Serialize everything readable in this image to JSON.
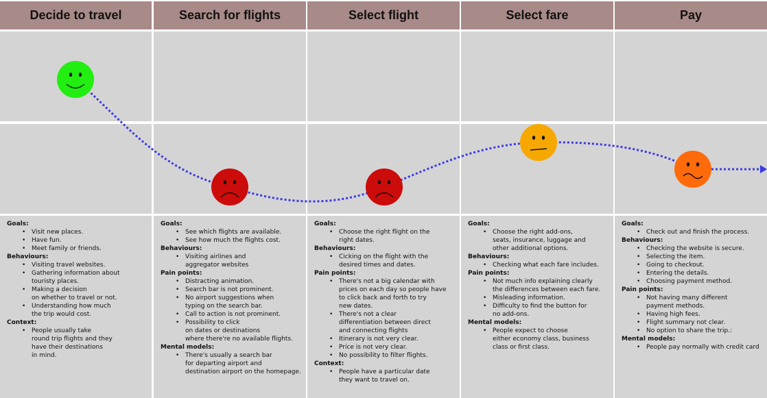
{
  "stages": [
    {
      "title": "Decide to travel",
      "mood": "happy",
      "sections": [
        {
          "label": "Goals:",
          "items": [
            "Visit new places.",
            "Have fun.",
            "Meet family or friends."
          ]
        },
        {
          "label": "Behaviours:",
          "items": [
            "Visiting travel websites.",
            "Gathering information about\ntouristy places.",
            "Making a decision\non whether to travel or not.",
            "Understanding how much\nthe trip would cost."
          ]
        },
        {
          "label": "Context:",
          "items": [
            "People usually take\nround trip flights and they\nhave their destinations\nin mind."
          ]
        }
      ]
    },
    {
      "title": "Search for flights",
      "mood": "sad",
      "sections": [
        {
          "label": "Goals:",
          "items": [
            "See which flights are available.",
            "See how much the flights cost."
          ]
        },
        {
          "label": "Behaviours:",
          "items": [
            "Visiting airlines and\naggregator websites"
          ]
        },
        {
          "label": "Pain points:",
          "items": [
            "Distracting animation.",
            "Search bar is not prominent.",
            "No airport suggestions when\ntyping on the search bar.",
            "Call to action is not prominent.",
            "Possibility to click\non dates or destinations\nwhere there're no available flights."
          ]
        },
        {
          "label": "Mental models:",
          "items": [
            "There's usually a search bar\nfor departing airport and\ndestination airport on the homepage."
          ]
        }
      ]
    },
    {
      "title": "Select flight",
      "mood": "sad",
      "sections": [
        {
          "label": "Goals:",
          "items": [
            "Choose the right flight on the\nright dates."
          ]
        },
        {
          "label": "Behaviours:",
          "items": [
            "Cicking on the flight with the\ndesired times and dates."
          ]
        },
        {
          "label": "Pain points:",
          "items": [
            "There's not a big calendar with\nprices on each day so people have\nto click back and forth to try\nnew dates.",
            "There's not a clear\ndifferentiation between direct\nand connecting flights",
            "Itinerary is not very clear.",
            "Price is not very clear.",
            "No possibility to filter flights."
          ]
        },
        {
          "label": "Context:",
          "items": [
            "People have a particular date\nthey want to travel on."
          ]
        }
      ]
    },
    {
      "title": "Select fare",
      "mood": "neutral",
      "sections": [
        {
          "label": "Goals:",
          "items": [
            "Choose the right add-ons,\nseats, insurance, luggage and\nother additional options."
          ]
        },
        {
          "label": "Behaviours:",
          "items": [
            "Checking what each fare includes."
          ]
        },
        {
          "label": "Pain points:",
          "items": [
            "Not much info explaining clearly\nthe differences between each fare.",
            "Misleading information.",
            "Difficulty to find the button for\nno add-ons."
          ]
        },
        {
          "label": "Mental models:",
          "items": [
            "People expect to choose\neither economy class, business\nclass or first class."
          ]
        }
      ]
    },
    {
      "title": "Pay",
      "mood": "unhappy",
      "sections": [
        {
          "label": "Goals:",
          "items": [
            "Check out and finish the process."
          ]
        },
        {
          "label": "Behaviours:",
          "items": [
            "Checking the website is secure.",
            "Selecting the item.",
            "Going to checkout.",
            "Entering the details.",
            "Choosing payment method."
          ]
        },
        {
          "label": "Pain points:",
          "items": [
            "Not having many different\npayment methods.",
            "Having high fees.",
            "Flight summary not clear.",
            "No option to share the trip.:"
          ]
        },
        {
          "label": "Mental models:",
          "items": [
            "People pay normally with credit card"
          ]
        }
      ]
    }
  ],
  "colors": {
    "header_bg": "#a88a88",
    "cell_bg": "#d4d4d4",
    "curve": "#3a3ae6",
    "happy": "#22ee11",
    "sad": "#cc0b0b",
    "neutral": "#f7a800",
    "unhappy": "#ff6a0a"
  }
}
